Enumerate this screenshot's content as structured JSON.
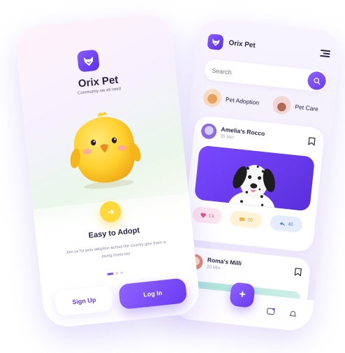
{
  "colors": {
    "accent": "#7A4CF5",
    "accent_dark": "#6A3AF0",
    "yellow": "#FFD83A",
    "text_dark": "#2A2344"
  },
  "feed": {
    "brand": "Orix Pet",
    "search": {
      "placeholder": "Search"
    },
    "categories": [
      {
        "label": "Pet Adoption",
        "icon": "pet-adoption-thumb"
      },
      {
        "label": "Pet Care",
        "icon": "pet-care-thumb"
      }
    ],
    "posts": [
      {
        "name": "Amelia's Rocco",
        "time": "35 Min",
        "reactions": {
          "likes": "1.k",
          "comments": "20",
          "shares": "40"
        }
      },
      {
        "name": "Roma's Milli",
        "time": "20 Min"
      }
    ]
  },
  "onboarding": {
    "brand": "Orix Pet",
    "tagline": "Community we all need",
    "title": "Easy to Adopt",
    "description": "Join us for pets adoption across the country give them a loving home too.",
    "signup_label": "Sign Up",
    "login_label": "Log In",
    "dots": {
      "count": 3,
      "active": 1
    }
  }
}
